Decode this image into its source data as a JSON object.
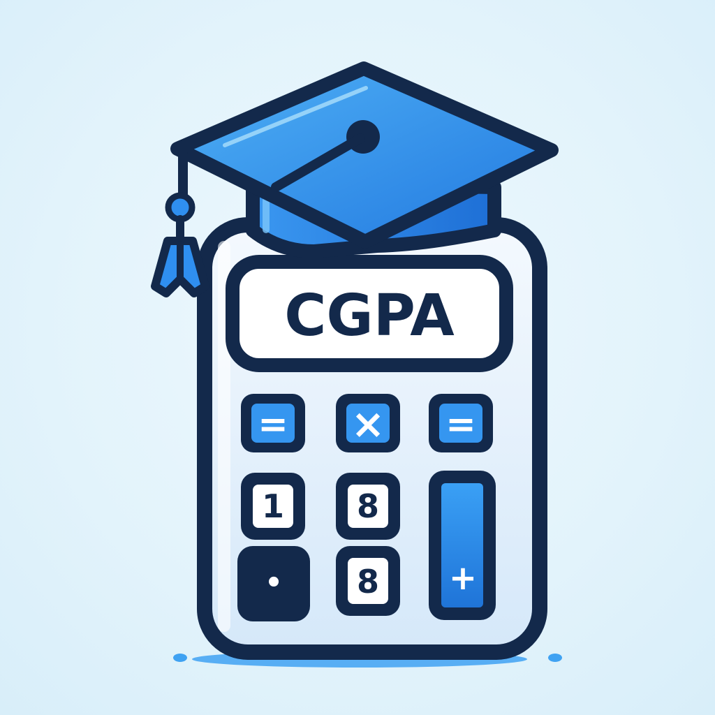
{
  "display": {
    "text": "CGPA"
  },
  "keys": {
    "row1": [
      "=",
      "×",
      "="
    ],
    "row2": [
      "1",
      "8"
    ],
    "row3": [
      "•",
      "8"
    ],
    "tall": "+"
  },
  "icons": {
    "cap": "graduation-cap-icon",
    "tassel": "tassel-icon",
    "calculator": "calculator-icon"
  },
  "colors": {
    "outline": "#13294b",
    "blue": "#2f8ff0",
    "blue_dark": "#1f74d8",
    "blue_light": "#56b3f6",
    "body_fill": "#e6f2fc",
    "screen_fill": "#ffffff",
    "background": "#e2f3fb"
  }
}
